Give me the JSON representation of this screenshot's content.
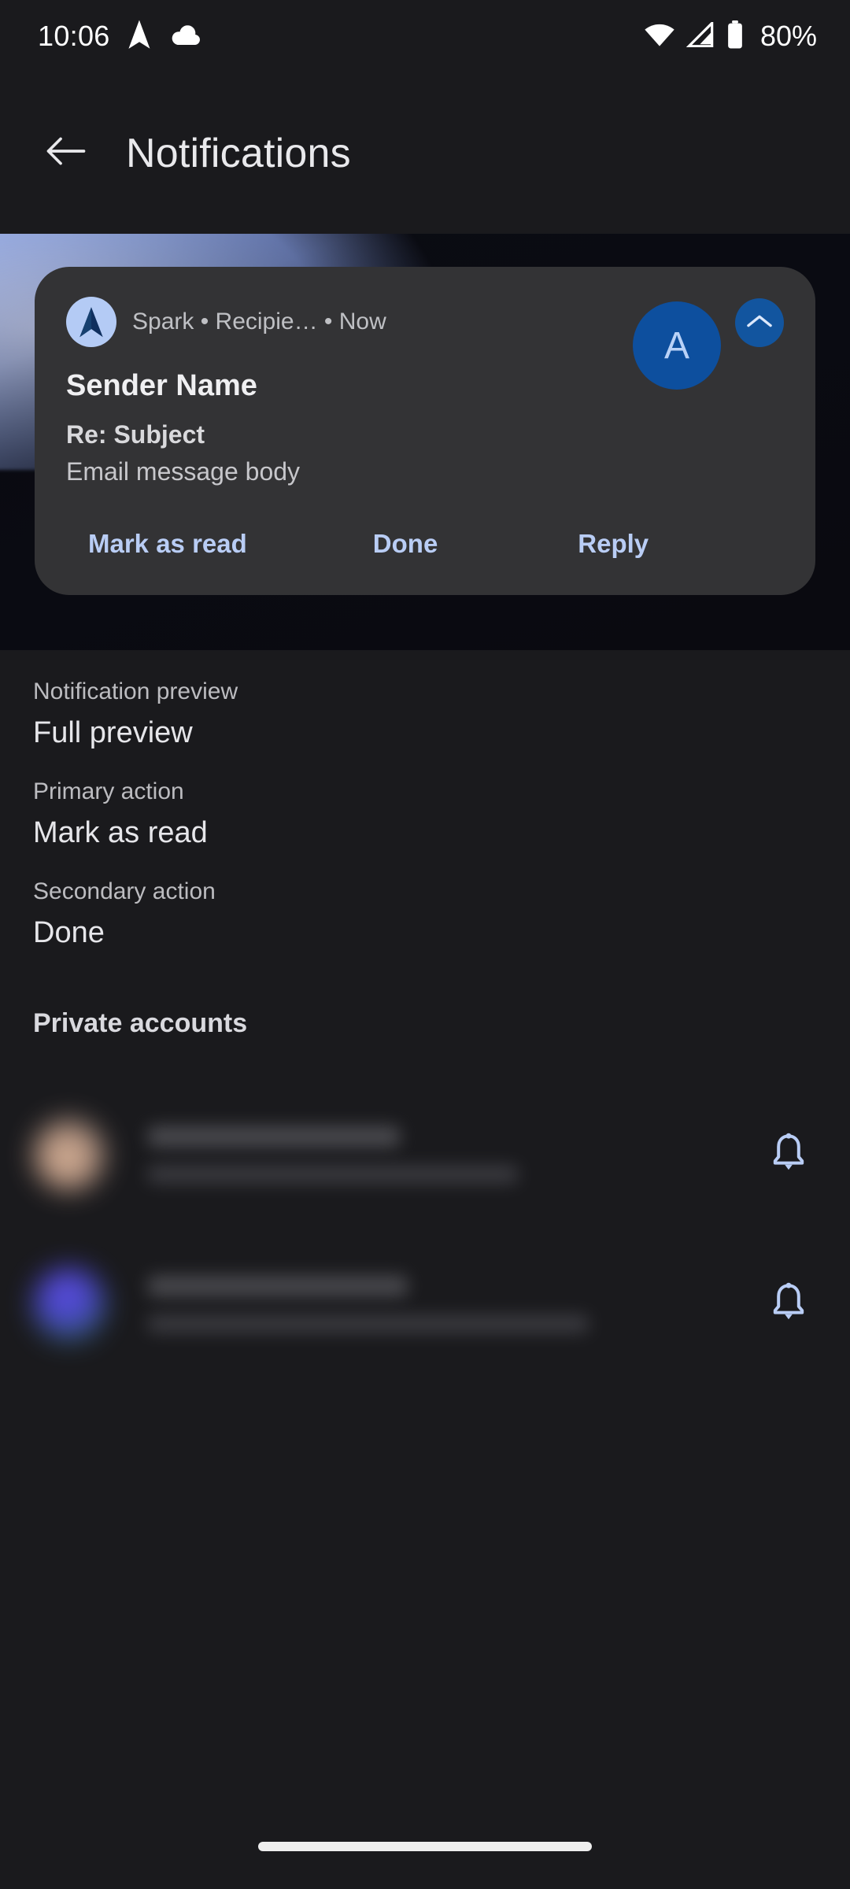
{
  "theme": {
    "background": "#1a1a1d",
    "card_bg": "#333335",
    "accent_blue": "#b9cdf5",
    "avatar_blue": "#0d4f9e",
    "app_icon_bg": "#b4cbf5",
    "text_primary": "#e9e9ec",
    "text_secondary": "#bcbcc0"
  },
  "status_bar": {
    "clock": "10:06",
    "battery_percent": "80%",
    "left_icons": [
      "spark-plane-icon",
      "cloud-icon"
    ],
    "right_icons": [
      "wifi-icon",
      "cellular-signal-icon",
      "battery-icon"
    ]
  },
  "app_bar": {
    "back_icon": "arrow-back-icon",
    "title": "Notifications"
  },
  "notification_preview": {
    "app_name": "Spark",
    "separator": "•",
    "recipient": "Recipie…",
    "time": "Now",
    "header_line": "Spark • Recipie…  • Now",
    "sender": "Sender Name",
    "subject": "Re: Subject",
    "body": "Email message body",
    "avatar_letter": "A",
    "expand_icon": "chevron-up-icon",
    "app_icon": "spark-plane-icon",
    "actions": [
      {
        "label": "Mark as read"
      },
      {
        "label": "Done"
      },
      {
        "label": "Reply"
      }
    ]
  },
  "settings": [
    {
      "label": "Notification preview",
      "value": "Full preview"
    },
    {
      "label": "Primary action",
      "value": "Mark as read"
    },
    {
      "label": "Secondary action",
      "value": "Done"
    }
  ],
  "private_accounts": {
    "heading": "Private accounts",
    "items": [
      {
        "name": "",
        "email": "",
        "avatar": "redacted-avatar",
        "trailing_icon": "bell-icon"
      },
      {
        "name": "",
        "email": "",
        "avatar": "redacted-avatar",
        "trailing_icon": "bell-icon"
      }
    ]
  },
  "nav_bar": {
    "gesture_pill": "home-gesture-pill"
  }
}
